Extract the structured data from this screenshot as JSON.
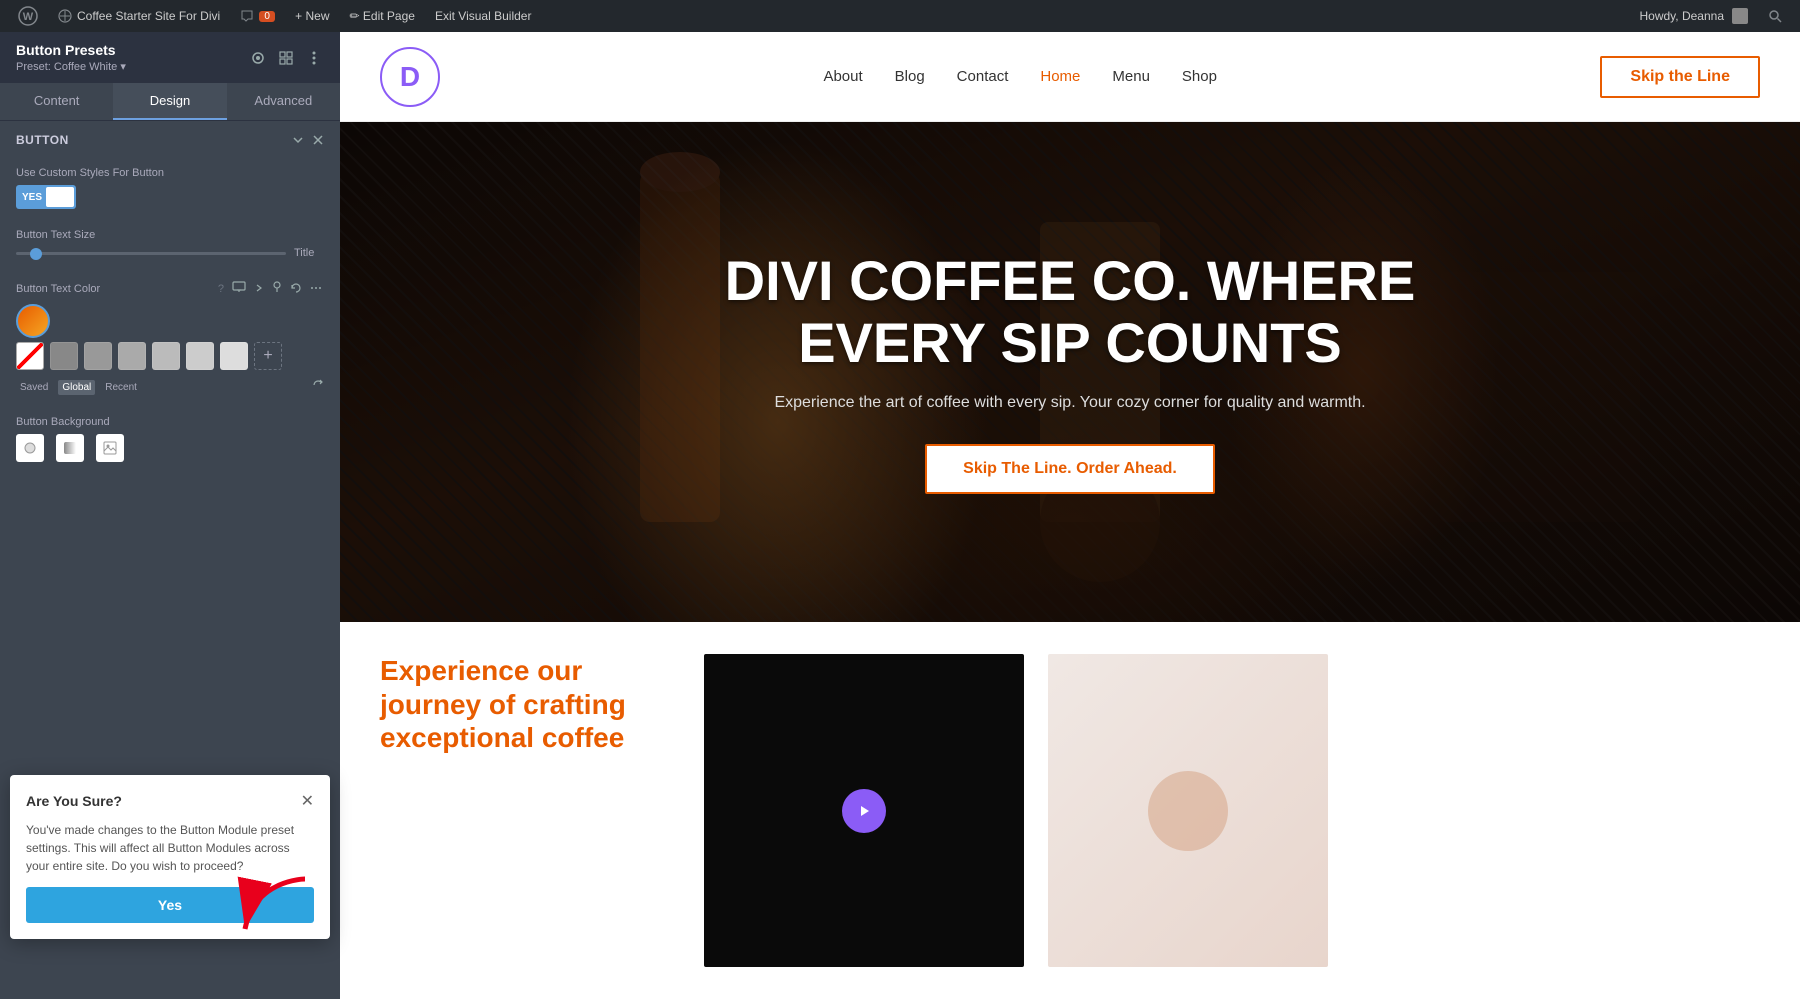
{
  "adminBar": {
    "wpIcon": "⊕",
    "siteName": "Coffee Starter Site For Divi",
    "commentCount": "0",
    "newLabel": "+ New",
    "editPageLabel": "✏ Edit Page",
    "exitBuilderLabel": "Exit Visual Builder",
    "howdy": "Howdy, Deanna",
    "searchIcon": "🔍"
  },
  "panel": {
    "title": "Button Presets",
    "subtitle": "Preset: Coffee White ▾",
    "icons": [
      "⊙",
      "⊞",
      "⋮"
    ],
    "tabs": [
      "Content",
      "Design",
      "Advanced"
    ],
    "activeTab": "Design",
    "sections": {
      "button": {
        "title": "Button",
        "fields": {
          "customStyles": {
            "label": "Use Custom Styles For Button",
            "value": "YES",
            "enabled": true
          },
          "textSize": {
            "label": "Button Text Size",
            "unit": "Title"
          },
          "textColor": {
            "label": "Button Text Color",
            "swatches": [
              {
                "color": "transparent",
                "type": "transparent"
              },
              {
                "color": "#888888"
              },
              {
                "color": "#999999"
              },
              {
                "color": "#aaaaaa"
              },
              {
                "color": "#bbbbbb"
              },
              {
                "color": "#cccccc"
              }
            ],
            "tags": [
              "Saved",
              "Global",
              "Recent"
            ],
            "activeTag": "Global"
          },
          "background": {
            "label": "Button Background",
            "icons": [
              "gradient",
              "image",
              "pattern"
            ]
          }
        }
      }
    }
  },
  "confirmDialog": {
    "title": "Are You Sure?",
    "body": "You've made changes to the Button Module preset settings. This will affect all Button Modules across your entire site. Do you wish to proceed?",
    "yesLabel": "Yes"
  },
  "siteHeader": {
    "logoLetter": "D",
    "navItems": [
      {
        "label": "About",
        "active": false
      },
      {
        "label": "Blog",
        "active": false
      },
      {
        "label": "Contact",
        "active": false
      },
      {
        "label": "Home",
        "active": true
      },
      {
        "label": "Menu",
        "active": false
      },
      {
        "label": "Shop",
        "active": false
      }
    ],
    "ctaButton": "Skip the Line"
  },
  "hero": {
    "title": "DIVI COFFEE CO. WHERE EVERY SIP COUNTS",
    "subtitle": "Experience the art of coffee with every sip. Your cozy corner for quality and warmth.",
    "ctaButton": "Skip The Line. Order Ahead."
  },
  "bottomSection": {
    "heading": "Experience our journey of crafting exceptional coffee"
  }
}
